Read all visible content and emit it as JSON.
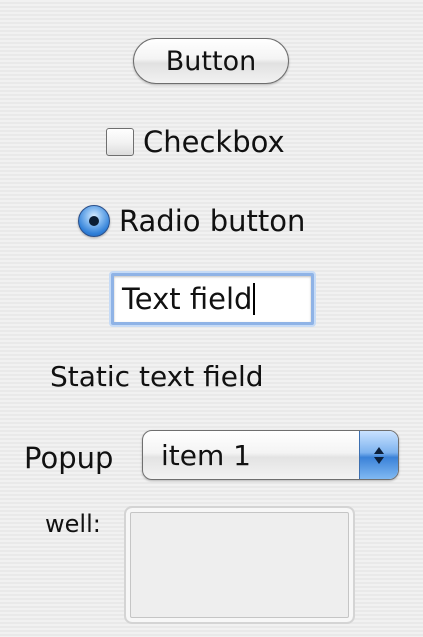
{
  "controls": {
    "button_label": "Button",
    "checkbox": {
      "label": "Checkbox",
      "checked": false
    },
    "radio": {
      "label": "Radio button",
      "selected": true
    },
    "text_field": {
      "value": "Text field"
    },
    "static_text": "Static text field",
    "popup": {
      "label": "Popup",
      "selected": "item 1"
    },
    "well": {
      "label": "well:"
    }
  },
  "colors": {
    "accent": "#3b82d8",
    "focus_ring": "#8fb3e6"
  }
}
